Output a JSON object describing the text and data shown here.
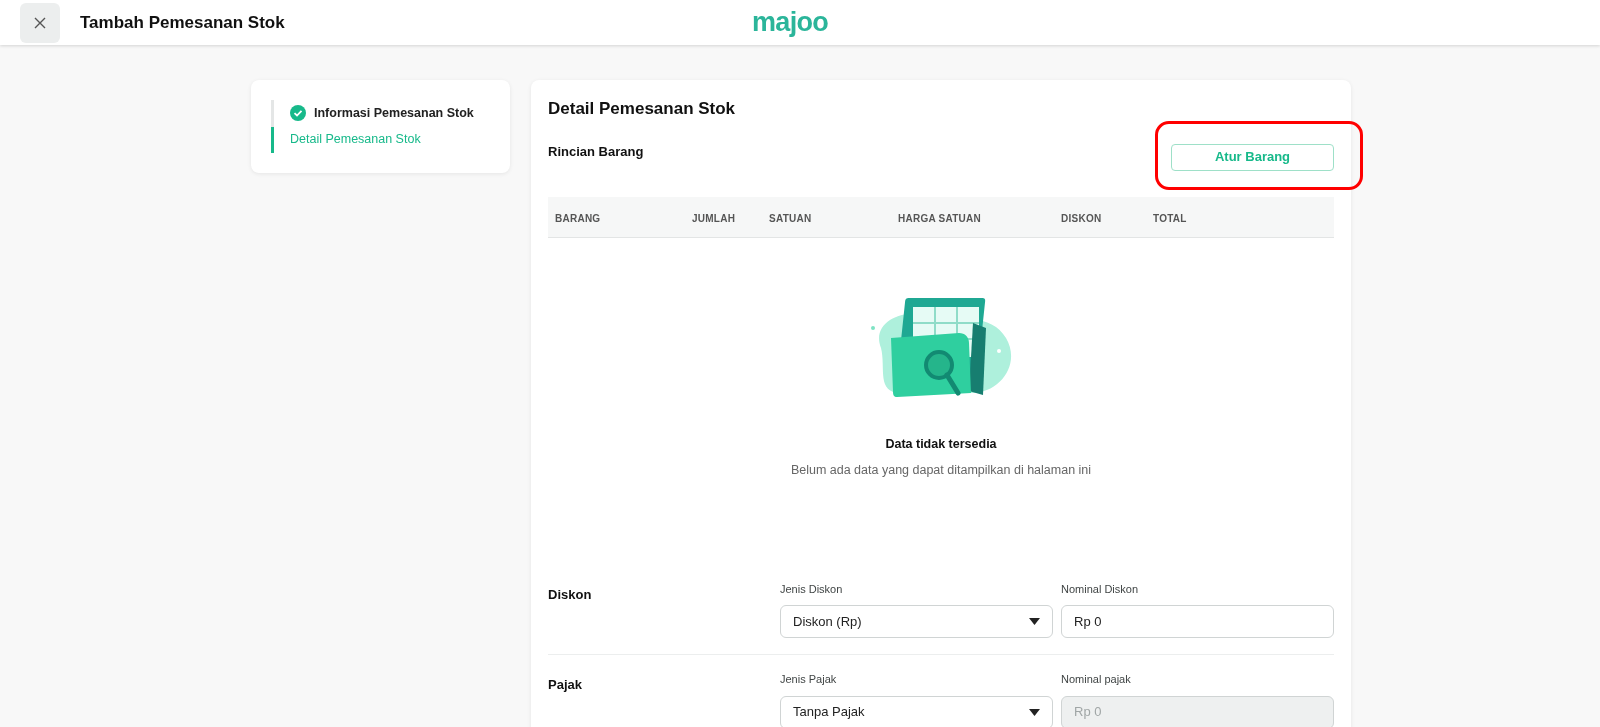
{
  "header": {
    "title": "Tambah Pemesanan Stok",
    "logo": "majoo"
  },
  "steps": [
    {
      "label": "Informasi Pemesanan Stok",
      "done": true,
      "selected": false
    },
    {
      "label": "Detail Pemesanan Stok",
      "done": false,
      "selected": true
    }
  ],
  "main": {
    "title": "Detail Pemesanan Stok",
    "section": "Rincian Barang",
    "action": {
      "label": "Atur Barang",
      "highlighted": true
    }
  },
  "table": {
    "columns": [
      "BARANG",
      "JUMLAH",
      "SATUAN",
      "HARGA SATUAN",
      "DISKON",
      "TOTAL"
    ],
    "empty": {
      "title": "Data tidak tersedia",
      "message": "Belum ada data yang dapat ditampilkan di halaman ini"
    }
  },
  "sections": [
    {
      "label": "Diskon",
      "fields": [
        {
          "kind": "select",
          "label": "Jenis Diskon",
          "value": "Diskon (Rp)",
          "disabled": false
        },
        {
          "kind": "input",
          "label": "Nominal Diskon",
          "value": "Rp 0",
          "disabled": false
        }
      ]
    },
    {
      "label": "Pajak",
      "fields": [
        {
          "kind": "select",
          "label": "Jenis Pajak",
          "value": "Tanpa Pajak",
          "disabled": false
        },
        {
          "kind": "input",
          "label": "Nominal pajak",
          "value": "Rp 0",
          "disabled": true
        }
      ]
    }
  ]
}
